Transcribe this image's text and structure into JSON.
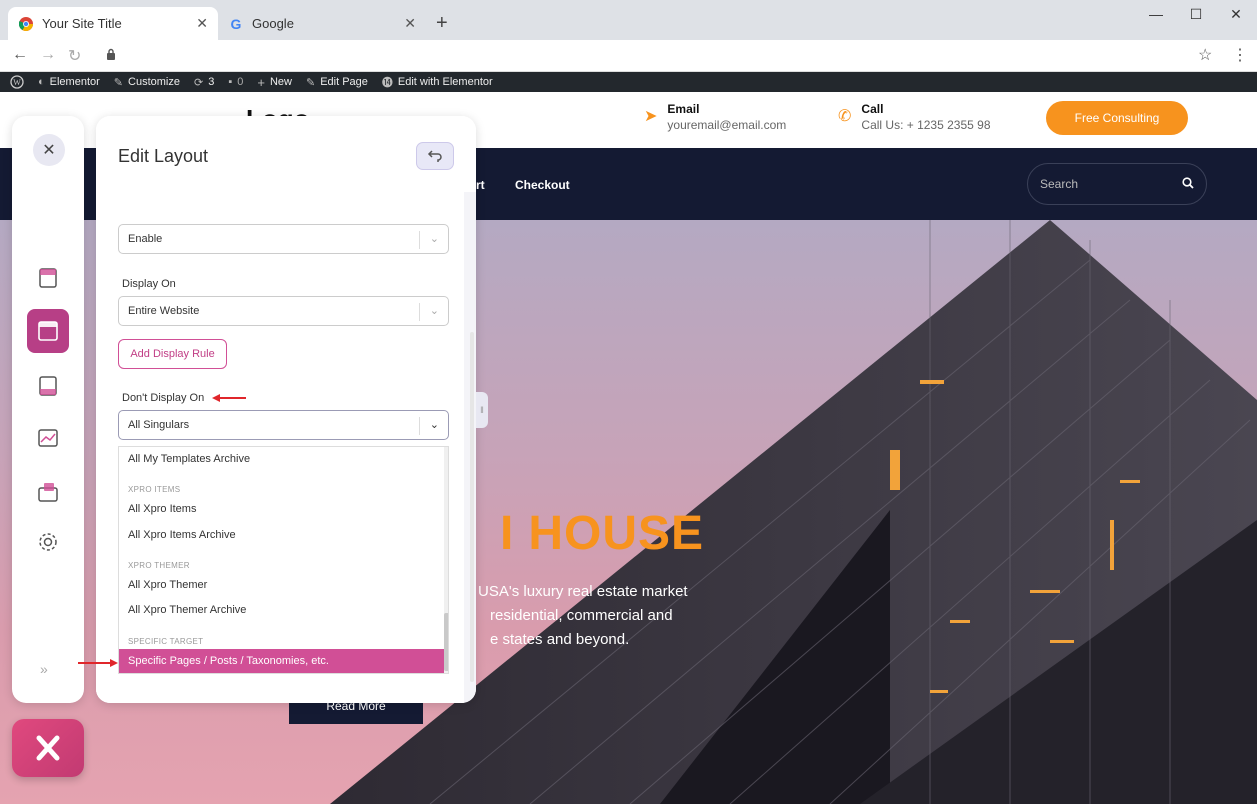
{
  "browser": {
    "tabs": [
      {
        "title": "Your Site Title",
        "active": true
      },
      {
        "title": "Google",
        "active": false
      }
    ]
  },
  "wp_admin_bar": {
    "items": [
      {
        "label": "Elementor",
        "icon": "palette-icon"
      },
      {
        "label": "Customize",
        "icon": "brush-icon"
      },
      {
        "label": "3",
        "icon": "refresh-icon"
      },
      {
        "label": "0",
        "icon": "comment-icon"
      },
      {
        "label": "New",
        "icon": "plus-icon"
      },
      {
        "label": "Edit Page",
        "icon": "pencil-icon"
      },
      {
        "label": "Edit with Elementor",
        "icon": "elementor-icon"
      }
    ]
  },
  "site": {
    "logo": "Logo",
    "email": {
      "label": "Email",
      "value": "youremail@email.com"
    },
    "call": {
      "label": "Call",
      "value": "Call Us: + 1235 2355 98"
    },
    "cta_label": "Free Consulting",
    "nav": {
      "cart_fragment": "rt",
      "checkout": "Checkout"
    },
    "search_placeholder": "Search",
    "hero_title": "HOUSE",
    "hero_text_lines": [
      "USA's luxury real estate market",
      "residential, commercial and",
      "e states and beyond."
    ],
    "read_more": "Read More",
    "hero_letter": "I"
  },
  "panel": {
    "title": "Edit Layout",
    "status_value": "Enable",
    "display_on_label": "Display On",
    "display_on_value": "Entire Website",
    "add_rule_label": "Add Display Rule",
    "dont_display_label": "Don't Display On",
    "dont_display_value": "All Singulars",
    "dropdown": {
      "items": [
        {
          "type": "item",
          "label": "All My Templates Archive"
        },
        {
          "type": "group",
          "label": "XPRO ITEMS"
        },
        {
          "type": "item",
          "label": "All Xpro Items"
        },
        {
          "type": "item",
          "label": "All Xpro Items Archive"
        },
        {
          "type": "group",
          "label": "XPRO THEMER"
        },
        {
          "type": "item",
          "label": "All Xpro Themer"
        },
        {
          "type": "item",
          "label": "All Xpro Themer Archive"
        },
        {
          "type": "group",
          "label": "SPECIFIC TARGET"
        },
        {
          "type": "item",
          "label": "Specific Pages / Posts / Taxonomies, etc.",
          "selected": true
        }
      ]
    }
  },
  "colors": {
    "accent": "#d14f96",
    "brand_orange": "#f7931e",
    "nav_dark": "#141a33",
    "annotation_red": "#e0262b"
  }
}
